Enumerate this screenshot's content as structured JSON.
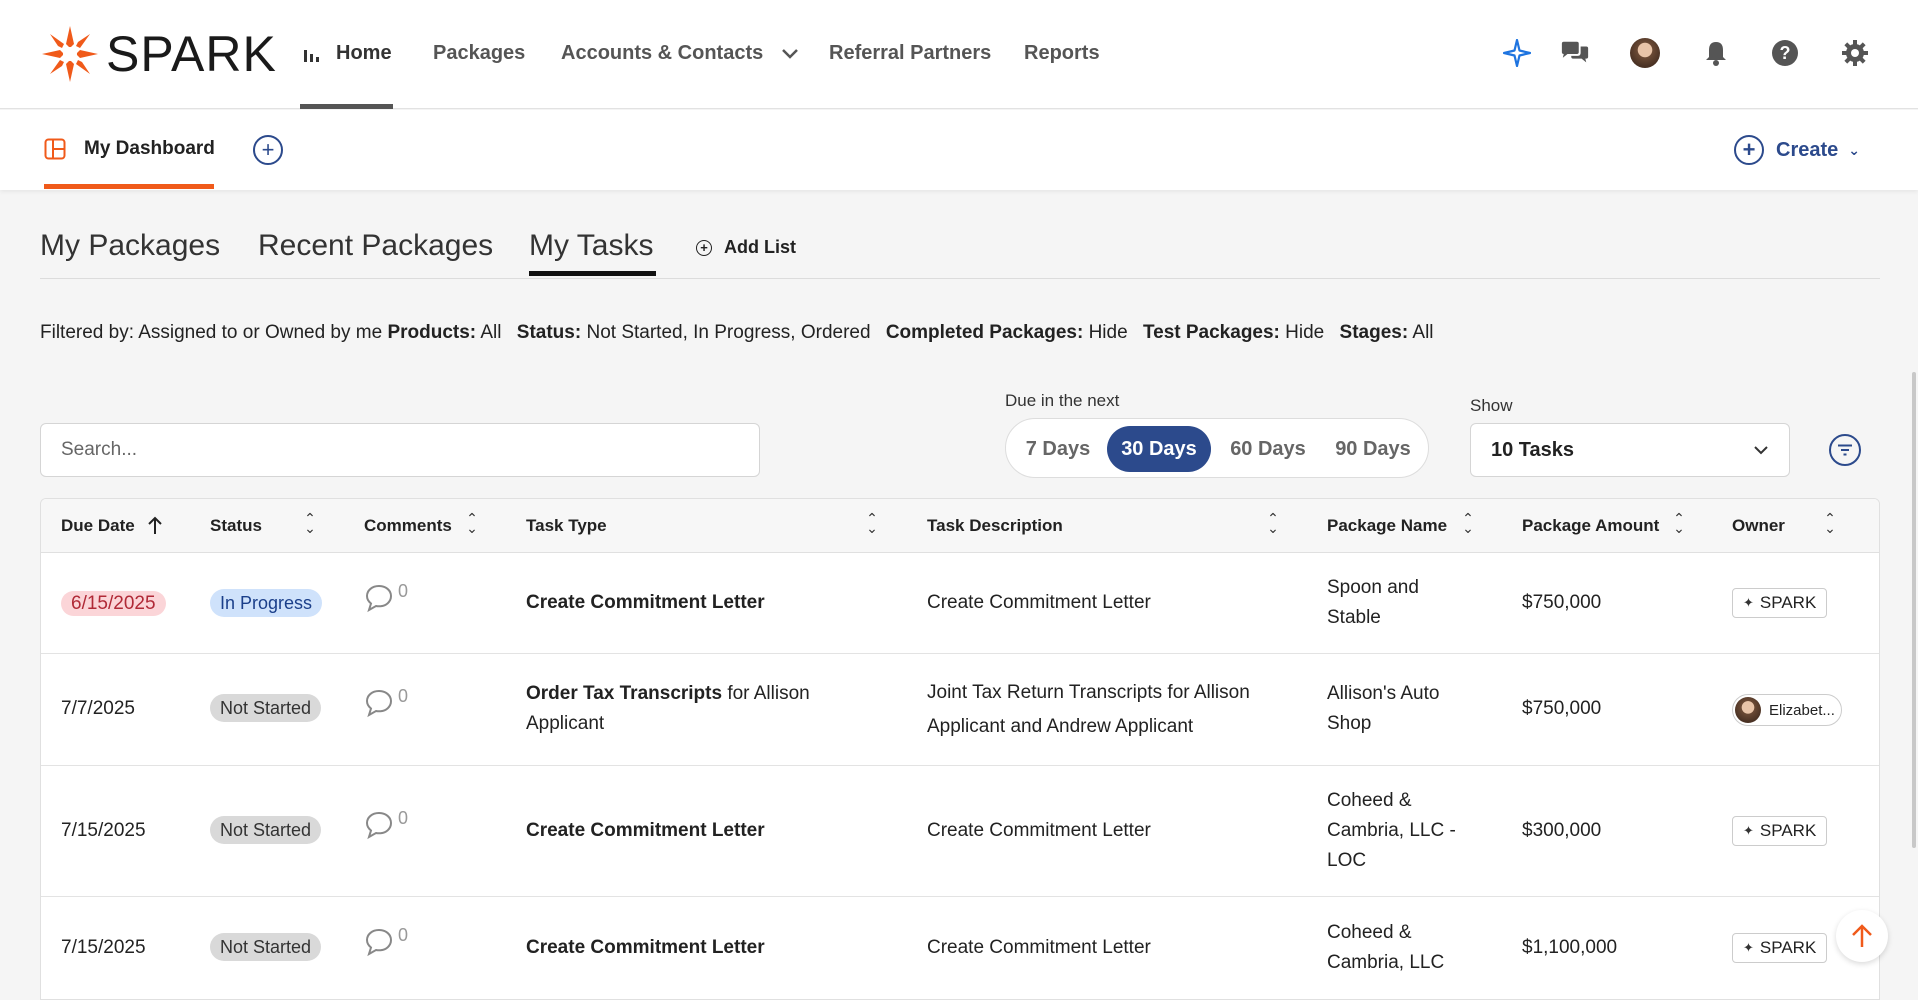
{
  "brand": {
    "name": "SPARK",
    "accent": "#f05a1a",
    "primary": "#2c4a8c"
  },
  "nav": {
    "items": [
      {
        "label": "Home",
        "active": true
      },
      {
        "label": "Packages"
      },
      {
        "label": "Accounts & Contacts"
      },
      {
        "label": "Referral Partners"
      },
      {
        "label": "Reports"
      }
    ],
    "icons": [
      "sparkle-icon",
      "chat-icon",
      "user-avatar",
      "bell-icon",
      "help-icon",
      "gear-icon"
    ]
  },
  "subbar": {
    "dashboard_label": "My Dashboard",
    "create_label": "Create"
  },
  "tabs": {
    "my_packages": "My Packages",
    "recent_packages": "Recent Packages",
    "my_tasks": "My Tasks",
    "add_list": "Add List"
  },
  "filters": {
    "prefix": "Filtered by: Assigned to or Owned by me",
    "products_label": "Products:",
    "products_value": "All",
    "status_label": "Status:",
    "status_value": "Not Started, In Progress, Ordered",
    "completed_label": "Completed Packages:",
    "completed_value": "Hide",
    "test_label": "Test Packages:",
    "test_value": "Hide",
    "stages_label": "Stages:",
    "stages_value": "All"
  },
  "controls": {
    "search_placeholder": "Search...",
    "due_label": "Due in the next",
    "due_options": [
      "7 Days",
      "30 Days",
      "60 Days",
      "90 Days"
    ],
    "due_selected": "30 Days",
    "show_label": "Show",
    "show_value": "10 Tasks"
  },
  "table": {
    "headers": [
      "Due Date",
      "Status",
      "Comments",
      "Task Type",
      "Task Description",
      "Package Name",
      "Package Amount",
      "Owner"
    ],
    "rows": [
      {
        "due": "6/15/2025",
        "status": "In Progress",
        "comments": "0",
        "task_type_bold": "Create Commitment Letter",
        "task_type_rest": "",
        "description": "Create Commitment Letter",
        "package": "Spoon and Stable",
        "amount": "$750,000",
        "owner": "SPARK"
      },
      {
        "due": "7/7/2025",
        "status": "Not Started",
        "comments": "0",
        "task_type_bold": "Order Tax Transcripts",
        "task_type_rest": " for Allison Applicant",
        "description": "Joint Tax Return Transcripts for Allison Applicant and Andrew Applicant",
        "package": "Allison's Auto Shop",
        "amount": "$750,000",
        "owner": "Elizabet..."
      },
      {
        "due": "7/15/2025",
        "status": "Not Started",
        "comments": "0",
        "task_type_bold": "Create Commitment Letter",
        "task_type_rest": "",
        "description": "Create Commitment Letter",
        "package": "Coheed & Cambria, LLC - LOC",
        "amount": "$300,000",
        "owner": "SPARK"
      },
      {
        "due": "7/15/2025",
        "status": "Not Started",
        "comments": "0",
        "task_type_bold": "Create Commitment Letter",
        "task_type_rest": "",
        "description": "Create Commitment Letter",
        "package": "Coheed & Cambria, LLC",
        "amount": "$1,100,000",
        "owner": "SPARK"
      }
    ]
  }
}
